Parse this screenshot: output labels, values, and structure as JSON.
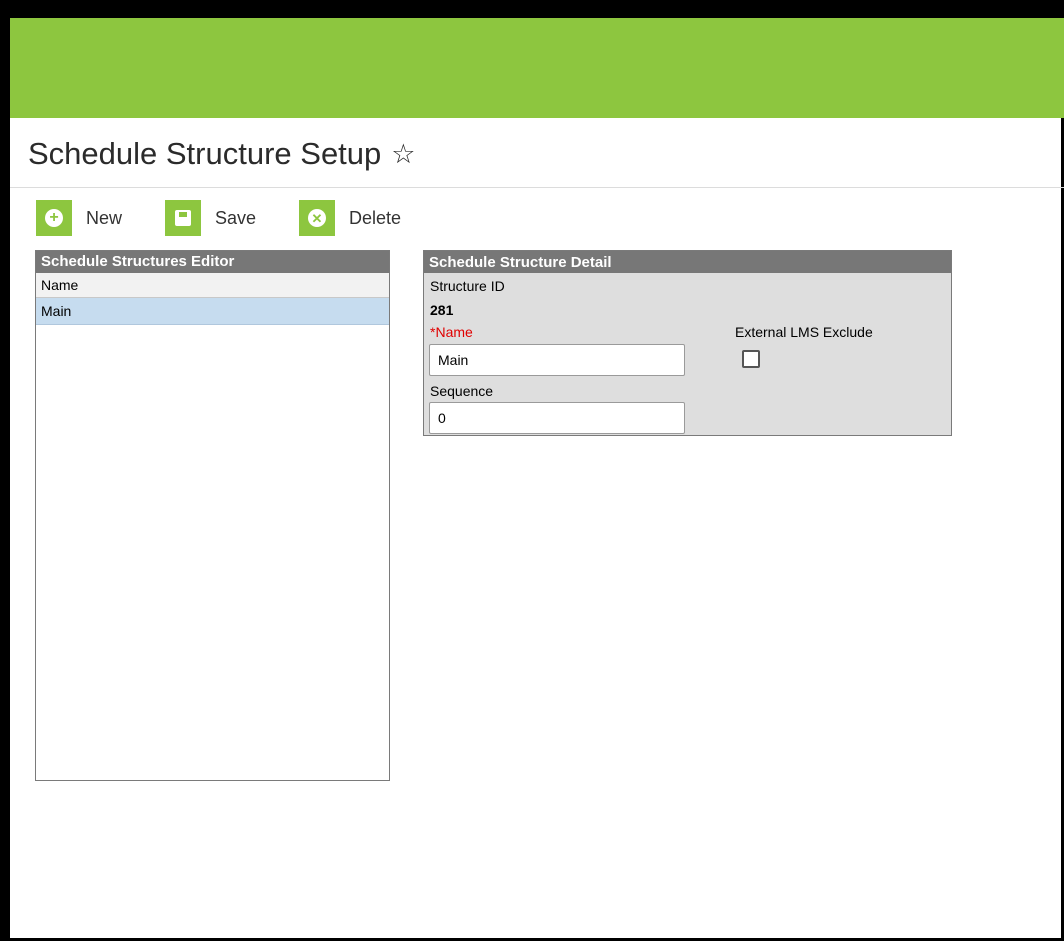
{
  "page": {
    "title": "Schedule Structure Setup",
    "star_icon": "☆"
  },
  "toolbar": {
    "new_label": "New",
    "save_label": "Save",
    "delete_label": "Delete"
  },
  "editor": {
    "header": "Schedule Structures Editor",
    "column_name": "Name",
    "rows": [
      {
        "name": "Main",
        "selected": true
      }
    ]
  },
  "detail": {
    "header": "Schedule Structure Detail",
    "structure_id_label": "Structure ID",
    "structure_id_value": "281",
    "name_required_marker": "*",
    "name_label": "Name",
    "name_value": "Main",
    "sequence_label": "Sequence",
    "sequence_value": "0",
    "lms_exclude_label": "External LMS Exclude",
    "lms_exclude_checked": false
  },
  "colors": {
    "brand_green": "#8dc63f",
    "panel_header": "#777777",
    "selected_row": "#c6dcef",
    "required_red": "#e00000"
  }
}
